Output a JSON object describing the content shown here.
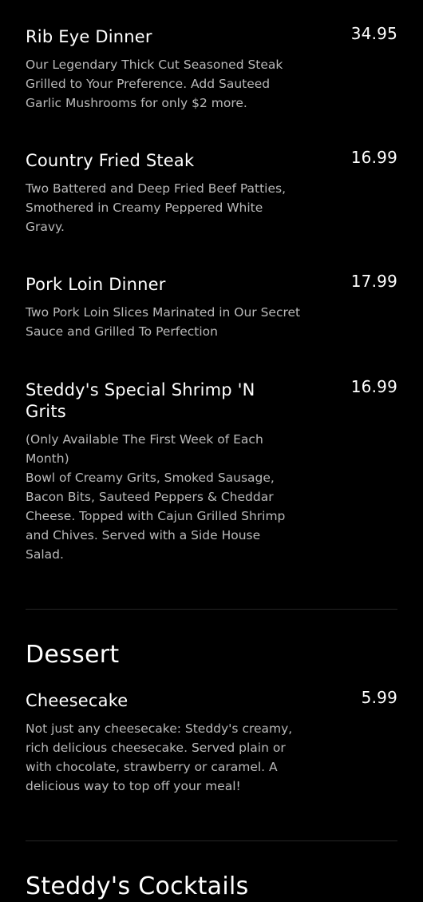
{
  "menu": {
    "items": [
      {
        "name": "Rib Eye Dinner",
        "price": "34.95",
        "description": "Our Legendary Thick Cut Seasoned Steak Grilled to Your Preference. Add Sauteed Garlic Mushrooms for only $2 more."
      },
      {
        "name": "Country Fried Steak",
        "price": "16.99",
        "description": "Two Battered and Deep Fried Beef Patties, Smothered in Creamy Peppered White Gravy."
      },
      {
        "name": "Pork Loin Dinner",
        "price": "17.99",
        "description": "Two Pork Loin Slices Marinated in Our Secret Sauce and Grilled To Perfection"
      },
      {
        "name": "Steddy's Special Shrimp 'N Grits",
        "price": "16.99",
        "description": "(Only Available The First Week of Each Month)\nBowl of Creamy Grits, Smoked Sausage, Bacon Bits, Sauteed Peppers & Cheddar Cheese. Topped with Cajun Grilled Shrimp and Chives. Served with a Side House Salad."
      }
    ],
    "dessert": {
      "title": "Dessert",
      "items": [
        {
          "name": "Cheesecake",
          "price": "5.99",
          "description": "Not just any cheesecake: Steddy's creamy, rich delicious cheesecake. Served plain or with chocolate, strawberry or caramel. A delicious way to top off your meal!"
        }
      ]
    },
    "cocktails": {
      "title": "Steddy's Cocktails"
    }
  }
}
